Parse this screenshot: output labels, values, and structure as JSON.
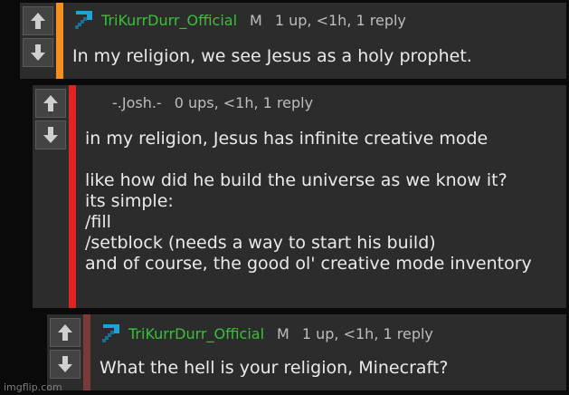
{
  "comments": [
    {
      "username": "TriKurrDurr_Official",
      "badge": "M",
      "stats": "1 up, <1h, 1 reply",
      "text": "In my religion, we see Jesus as a holy prophet.",
      "accent": "#f5901e",
      "name_color": "#3bbf3b",
      "icon": "diamond-pickaxe-icon"
    },
    {
      "username": "-.Josh.-",
      "badge": "",
      "stats": "0 ups, <1h, 1 reply",
      "text": "in my religion, Jesus has infinite creative mode\n\nlike how did he build the universe as we know it?\nits simple:\n/fill\n/setblock (needs a way to start his build)\nand of course, the good ol' creative mode inventory",
      "accent": "#e02424",
      "name_color": "#bdbdbd",
      "icon": ""
    },
    {
      "username": "TriKurrDurr_Official",
      "badge": "M",
      "stats": "1 up, <1h, 1 reply",
      "text": "What the hell is your religion, Minecraft?",
      "accent": "#7a3a3a",
      "name_color": "#3bbf3b",
      "icon": "diamond-pickaxe-icon"
    }
  ],
  "vote_icons": {
    "up": "arrow-up-icon",
    "down": "arrow-down-icon"
  },
  "watermark": "imgflip.com"
}
